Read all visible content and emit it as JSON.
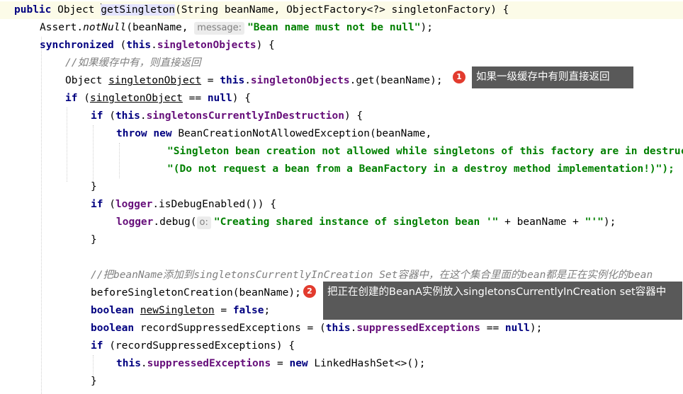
{
  "code": {
    "l1": {
      "kw_public": "public",
      "t1": " Object ",
      "method": "getSingleton",
      "t2": "(String beanName, ObjectFactory<?> singletonFactory) {"
    },
    "l2": {
      "t1": "Assert.",
      "call": "notNull",
      "t2": "(beanName, ",
      "hint": "message:",
      "str": "\"Bean name must not be null\"",
      "t3": ");"
    },
    "l3": {
      "kw_sync": "synchronized",
      "t1": " (",
      "kw_this": "this",
      "t2": ".",
      "field": "singletonObjects",
      "t3": ") {"
    },
    "l4": {
      "comment": "//如果缓存中有，则直接返回"
    },
    "l5": {
      "t1": "Object ",
      "var": "singletonObject",
      "t2": " = ",
      "kw_this": "this",
      "t3": ".",
      "field": "singletonObjects",
      "t4": ".get(beanName);"
    },
    "l6": {
      "kw_if": "if",
      "t1": " (",
      "var": "singletonObject",
      "t2": " == ",
      "kw_null": "null",
      "t3": ") {"
    },
    "l7": {
      "kw_if": "if",
      "t1": " (",
      "kw_this": "this",
      "t2": ".",
      "field": "singletonsCurrentlyInDestruction",
      "t3": ") {"
    },
    "l8": {
      "kw_throw": "throw",
      "t1": " ",
      "kw_new": "new",
      "t2": " BeanCreationNotAllowedException(beanName,"
    },
    "l9": {
      "str": "\"Singleton bean creation not allowed while singletons of this factory are in destruction \" +"
    },
    "l10": {
      "str": "\"(Do not request a bean from a BeanFactory in a destroy method implementation!)\");"
    },
    "l11": {
      "t1": "}"
    },
    "l12": {
      "kw_if": "if",
      "t1": " (",
      "field": "logger",
      "t2": ".isDebugEnabled()) {"
    },
    "l13": {
      "field": "logger",
      "t1": ".debug(",
      "hint": "o:",
      "str": "\"Creating shared instance of singleton bean '\"",
      "t2": " + beanName + ",
      "str2": "\"'\"",
      "t3": ");"
    },
    "l14": {
      "t1": "}"
    },
    "l15": {
      "comment": "//把beanName添加到singletonsCurrentlyInCreation Set容器中，在这个集合里面的bean都是正在实例化的bean"
    },
    "l16": {
      "t1": "beforeSingletonCreation(beanName);"
    },
    "l17": {
      "kw_boolean": "boolean",
      "t1": " ",
      "var": "newSingleton",
      "t2": " = ",
      "kw_false": "false",
      "t3": ";"
    },
    "l18": {
      "kw_boolean": "boolean",
      "t1": " recordSuppressedExceptions = (",
      "kw_this": "this",
      "t2": ".",
      "field": "suppressedExceptions",
      "t3": " == ",
      "kw_null": "null",
      "t4": ");"
    },
    "l19": {
      "kw_if": "if",
      "t1": " (recordSuppressedExceptions) {"
    },
    "l20": {
      "kw_this": "this",
      "t1": ".",
      "field": "suppressedExceptions",
      "t2": " = ",
      "kw_new": "new",
      "t3": " LinkedHashSet<>();"
    },
    "l21": {
      "t1": "}"
    }
  },
  "annotations": [
    {
      "number": "1",
      "text": "如果一级缓存中有则直接返回"
    },
    {
      "number": "2",
      "text": "把正在创建的BeanA实例放入singletonsCurrentlyInCreation set容器中"
    }
  ],
  "colors": {
    "keyword": "#000080",
    "field": "#660e7a",
    "string": "#008000",
    "comment": "#808080",
    "badge": "#e23b2e",
    "note_bg": "#595959"
  }
}
